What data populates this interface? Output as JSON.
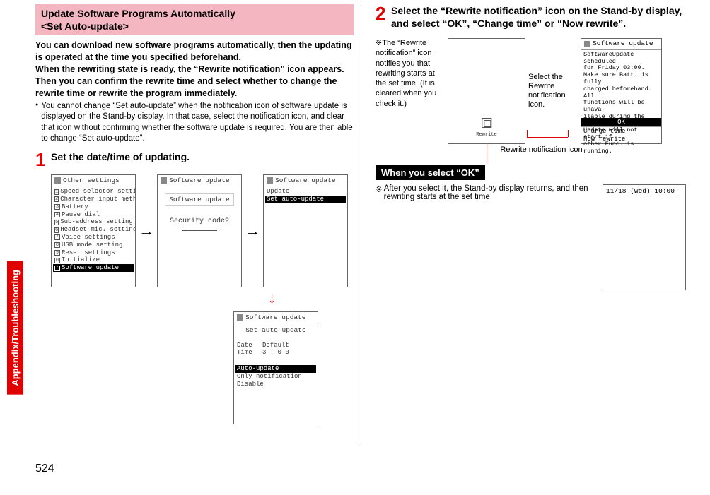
{
  "side_tab": "Appendix/Troubleshooting",
  "page_number": "524",
  "title_line1": "Update Software Programs Automatically",
  "title_line2": "<Set Auto-update>",
  "intro": "You can download new software programs automatically, then the updating is operated at the time you specified beforehand.\nWhen the rewriting state is ready, the “Rewrite notification” icon appears. Then you can confirm the rewrite time and select whether to change the rewrite time or rewrite the program immediately.",
  "bullet1": "You cannot change “Set auto-update” when the notification icon of software update is displayed on the Stand-by display. In that case, select the notification icon, and clear that icon without confirming whether the software update is required. You are then able to change “Set auto-update”.",
  "step1_num": "1",
  "step1_text": "Set the date/time of updating.",
  "screen1": {
    "header": "Other settings",
    "items": [
      "Speed selector setting",
      "Character input method",
      "Battery",
      "Pause dial",
      "Sub-address setting",
      "Headset mic. setting",
      "Voice settings",
      "USB mode setting",
      "Reset settings",
      "Initialize"
    ],
    "selected": "Software update"
  },
  "screen2": {
    "header": "Software update",
    "title": "Software update",
    "prompt": "Security code?"
  },
  "screen3": {
    "header": "Software update",
    "line": "Update",
    "selected": "Set auto-update"
  },
  "screen4": {
    "header": "Software update",
    "sub": "Set auto-update",
    "date_label": "Date",
    "date_val": "Default",
    "time_label": "Time",
    "time_val": "3 : 0 0",
    "selected": "Auto-update",
    "opts": [
      "Only notification",
      "Disable"
    ]
  },
  "step2_num": "2",
  "step2_text": "Select the “Rewrite notification” icon on the Stand-by display, and select “OK”, “Change time” or “Now rewrite”.",
  "note_star": "※",
  "note_text": "The “Rewrite notification” icon notifies you that rewriting starts at the set time. (It is cleared when you check it.)",
  "standby_icon_label": "Rewrite",
  "callout_label": "Select the Rewrite notification icon.",
  "update_screen": {
    "header": "Software update",
    "lines": [
      "SoftwareUpdate scheduled",
      "  for Friday 03:00.",
      "Make sure Batt. is fully",
      "charged beforehand. All",
      "functions will be unava-",
      "ilable during the update",
      "Update will not start if",
      "other Func. is running."
    ],
    "ok": "OK",
    "opt1": "Change time",
    "opt2": "Now rewrite"
  },
  "caption": "Rewrite notification icon",
  "section_ok": "When you select “OK”",
  "after_ok": "After you select it, the Stand-by display returns, and then rewriting starts at the set time.",
  "clock_screen": "11/18 (Wed) 10:00"
}
